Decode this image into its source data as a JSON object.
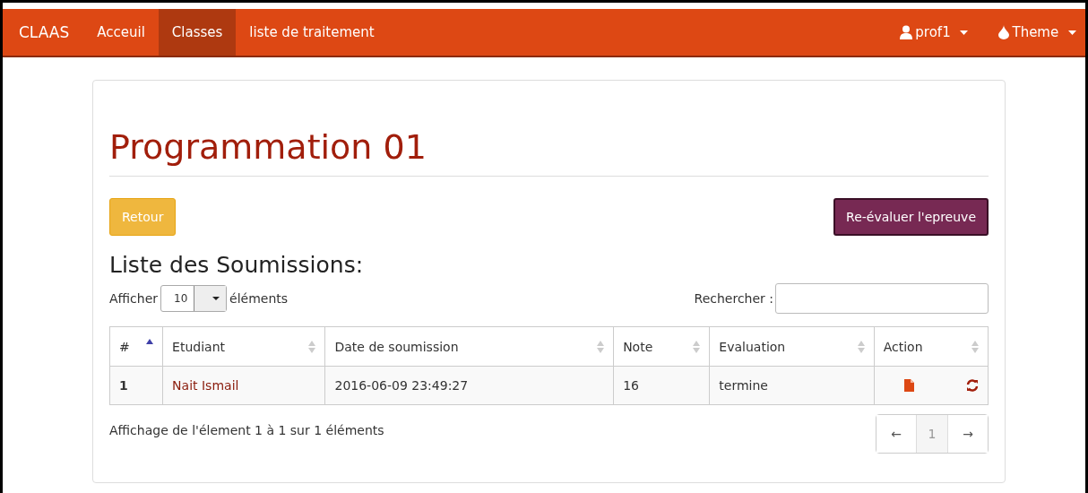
{
  "navbar": {
    "brand": "CLAAS",
    "items": [
      {
        "label": "Acceuil",
        "selected": false
      },
      {
        "label": "Classes",
        "selected": true
      },
      {
        "label": "liste de traitement",
        "selected": false
      }
    ],
    "user": "prof1",
    "theme": "Theme"
  },
  "page": {
    "title": "Programmation 01",
    "back_button": "Retour",
    "reevaluate_button": "Re-évaluer l'epreuve",
    "section_title": "Liste des Soumissions:"
  },
  "length": {
    "before": "Afficher",
    "value": "10",
    "after": "éléments"
  },
  "search": {
    "label": "Rechercher :"
  },
  "table": {
    "columns": [
      {
        "label": "#",
        "sorted": true
      },
      {
        "label": "Etudiant",
        "sorted": false
      },
      {
        "label": "Date de soumission",
        "sorted": false
      },
      {
        "label": "Note",
        "sorted": false
      },
      {
        "label": "Evaluation",
        "sorted": false
      },
      {
        "label": "Action",
        "sorted": false
      }
    ],
    "rows": [
      {
        "number": "1",
        "student": "Nait Ismail",
        "date": "2016-06-09 23:49:27",
        "note": "16",
        "evaluation": "termine"
      }
    ]
  },
  "info": "Affichage de l'élement 1 à 1 sur 1 éléments",
  "pagination": {
    "previous": "←",
    "pages": [
      {
        "label": "1",
        "selected": true
      }
    ],
    "next": "→"
  }
}
